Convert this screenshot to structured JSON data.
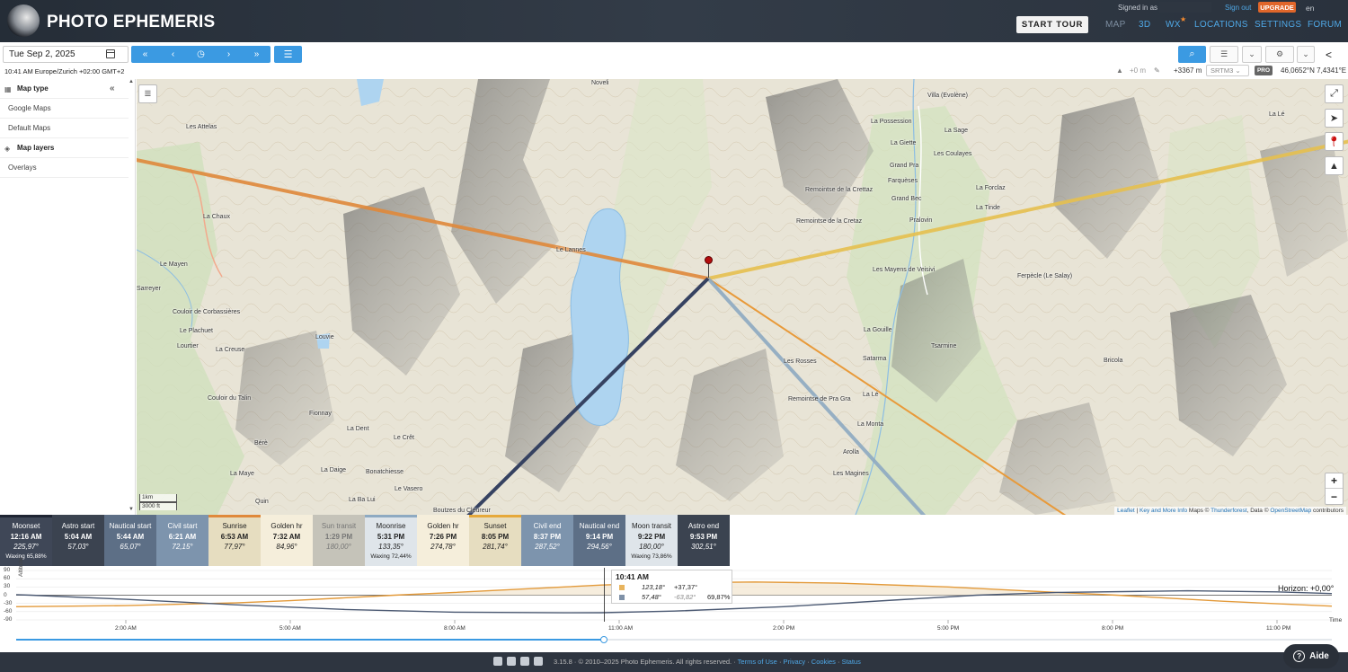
{
  "header": {
    "app_title": "PHOTO EPHEMERIS",
    "start_tour": "START TOUR",
    "nav": [
      {
        "label": "MAP"
      },
      {
        "label": "3D"
      },
      {
        "label": "WX"
      },
      {
        "label": "LOCATIONS"
      },
      {
        "label": "SETTINGS"
      },
      {
        "label": "FORUM"
      }
    ],
    "signed_in_as": "Signed in as",
    "sign_out": "Sign out",
    "upgrade": "UPGRADE",
    "language": "en"
  },
  "toolbar": {
    "date_value": "Tue Sep 2, 2025",
    "timezone_text": "10:41 AM Europe/Zurich +02:00 GMT+2",
    "nav_buttons": [
      "«",
      "‹",
      "◷",
      "›",
      "»"
    ],
    "elevation_offset": "+0 m",
    "elevation": "+3367 m",
    "dem_source": "SRTM3",
    "pro_badge": "PRO",
    "coordinates": "46,0652°N 7,4341°E"
  },
  "left_panel": {
    "items": [
      {
        "label": "Map type",
        "header": true
      },
      {
        "label": "Google Maps",
        "header": false
      },
      {
        "label": "Default Maps",
        "header": false
      },
      {
        "label": "Map layers",
        "header": true
      },
      {
        "label": "Overlays",
        "header": false
      }
    ]
  },
  "map": {
    "scale_metric": "1km",
    "scale_imperial": "3000 ft",
    "attribution": {
      "leaflet": "Leaflet",
      "sep1": " | ",
      "key": "Key and More Info",
      "maps": " Maps © ",
      "thunderforest": "Thunderforest",
      "data": ", Data © ",
      "osm": "OpenStreetMap",
      "contributors": " contributors"
    },
    "place_labels": [
      "Noveli",
      "Villa (Evolène)",
      "La Lé",
      "La Possession",
      "La Sage",
      "Les Attelas",
      "La Giette",
      "Les Coulayes",
      "Grand Pra",
      "Farquèses",
      "Remointse de la Crettaz",
      "La Forclaz",
      "Grand Bec",
      "La Tinde",
      "Remointse de la Cretaz",
      "Pralovin",
      "La Chaux",
      "Le Mayen",
      "Le Lannes",
      "Les Mayens de Veisivi",
      "Ferpècle (Le Salay)",
      "Sarreyer",
      "Couloir de Corbassières",
      "Le Plachuet",
      "La Gouille",
      "Louvie",
      "Tsarmine",
      "Lourtier",
      "La Creuse",
      "Satarma",
      "Bricola",
      "Les Rosses",
      "Remointse de Pra Gra",
      "La Lé",
      "Couloir du Talin",
      "La Monta",
      "Fionnay",
      "La Dent",
      "Le Crêt",
      "Bérè",
      "Arolla",
      "La Maye",
      "La Daige",
      "Bonatchiesse",
      "Les Magines",
      "Le Vasero",
      "Quin",
      "La Ba Lui",
      "Boutzes du Cleureur"
    ],
    "colors": {
      "sunrise": "#e0893b",
      "sunset": "#e6c04f",
      "moonrise": "#8eaac2",
      "moonset": "#364261"
    }
  },
  "events": [
    {
      "name": "Moonset",
      "time": "12:16 AM",
      "az": "225,97°",
      "extra": "Waxing 65,88%",
      "bg": "#3f4757",
      "fg": "#ffffff",
      "top": "#1f2533"
    },
    {
      "name": "Astro start",
      "time": "5:04 AM",
      "az": "57,03°",
      "extra": "",
      "bg": "#3b4350",
      "fg": "#ffffff",
      "top": "#3b4350"
    },
    {
      "name": "Nautical start",
      "time": "5:44 AM",
      "az": "65,07°",
      "extra": "",
      "bg": "#5d6f86",
      "fg": "#ffffff",
      "top": "#5d6f86"
    },
    {
      "name": "Civil start",
      "time": "6:21 AM",
      "az": "72,15°",
      "extra": "",
      "bg": "#7d94ad",
      "fg": "#ffffff",
      "top": "#7d94ad"
    },
    {
      "name": "Sunrise",
      "time": "6:53 AM",
      "az": "77,97°",
      "extra": "",
      "bg": "#e6ddc0",
      "fg": "#222222",
      "top": "#e0893b"
    },
    {
      "name": "Golden hr",
      "time": "7:32 AM",
      "az": "84,96°",
      "extra": "",
      "bg": "#f5eedb",
      "fg": "#222222",
      "top": "#f5eedb"
    },
    {
      "name": "Sun transit",
      "time": "1:29 PM",
      "az": "180,00°",
      "extra": "",
      "bg": "#c5c3b9",
      "fg": "#777777",
      "top": "#c5c3b9"
    },
    {
      "name": "Moonrise",
      "time": "5:31 PM",
      "az": "133,35°",
      "extra": "Waxing 72,44%",
      "bg": "#dfe5ea",
      "fg": "#222222",
      "top": "#8eaac2"
    },
    {
      "name": "Golden hr",
      "time": "7:26 PM",
      "az": "274,78°",
      "extra": "",
      "bg": "#f5eedb",
      "fg": "#222222",
      "top": "#f5eedb"
    },
    {
      "name": "Sunset",
      "time": "8:05 PM",
      "az": "281,74°",
      "extra": "",
      "bg": "#e6ddc0",
      "fg": "#222222",
      "top": "#e6a93b"
    },
    {
      "name": "Civil end",
      "time": "8:37 PM",
      "az": "287,52°",
      "extra": "",
      "bg": "#7d94ad",
      "fg": "#ffffff",
      "top": "#7d94ad"
    },
    {
      "name": "Nautical end",
      "time": "9:14 PM",
      "az": "294,56°",
      "extra": "",
      "bg": "#5d6f86",
      "fg": "#ffffff",
      "top": "#5d6f86"
    },
    {
      "name": "Moon transit",
      "time": "9:22 PM",
      "az": "180,00°",
      "extra": "Waxing 73,86%",
      "bg": "#dfe5ea",
      "fg": "#222222",
      "top": "#dfe5ea"
    },
    {
      "name": "Astro end",
      "time": "9:53 PM",
      "az": "302,51°",
      "extra": "",
      "bg": "#3b4350",
      "fg": "#ffffff",
      "top": "#3b4350"
    }
  ],
  "altitude_chart": {
    "y_axis_label": "Altitude",
    "y_ticks": [
      "90",
      "60",
      "30",
      "0",
      "-30",
      "-60",
      "-90"
    ],
    "x_ticks": [
      "2:00 AM",
      "5:00 AM",
      "8:00 AM",
      "11:00 AM",
      "2:00 PM",
      "5:00 PM",
      "8:00 PM",
      "11:00 PM"
    ],
    "x_axis_label": "Time",
    "horizon_label": "Horizon: +0,00°",
    "current_time_frac": 0.447,
    "tooltip": {
      "time": "10:41 AM",
      "sun_az": "123,18°",
      "sun_alt": "+37,37°",
      "moon_az": "57,48°",
      "moon_alt": "-63,82°",
      "moon_illum": "69,87%"
    }
  },
  "chart_data": {
    "type": "line",
    "xlabel": "Time",
    "ylabel": "Altitude",
    "ylim": [
      -90,
      90
    ],
    "series": [
      {
        "name": "Sun",
        "color": "#e39a3a",
        "x": [
          0,
          2,
          4,
          5,
          6.9,
          8,
          10,
          10.68,
          12,
          13.48,
          15,
          17,
          19,
          20.08,
          22,
          24
        ],
        "values": [
          -42,
          -38,
          -28,
          -20,
          0,
          10,
          30,
          37,
          45,
          48,
          44,
          30,
          10,
          0,
          -22,
          -40
        ]
      },
      {
        "name": "Moon",
        "color": "#4c5a73",
        "x": [
          0,
          0.27,
          2,
          4,
          6,
          8,
          10,
          10.68,
          12,
          14,
          16,
          17.52,
          19,
          21.37,
          23,
          24
        ],
        "values": [
          2,
          0,
          -15,
          -35,
          -52,
          -62,
          -64,
          -63.8,
          -58,
          -42,
          -18,
          0,
          10,
          16,
          12,
          6
        ]
      }
    ]
  },
  "footer": {
    "version_text": "3.15.8 · © 2010–2025 Photo Ephemeris. All rights reserved. · ",
    "terms": "Terms of Use",
    "privacy": "Privacy",
    "cookies": "Cookies",
    "status": "Status",
    "help": "Aide"
  }
}
